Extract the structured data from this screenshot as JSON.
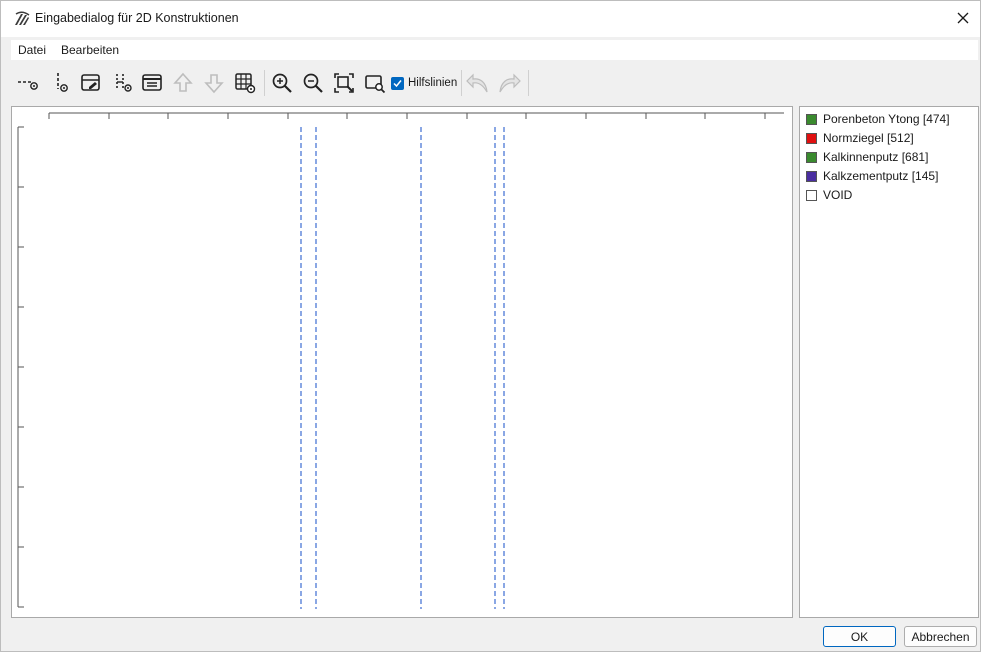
{
  "window": {
    "title": "Eingabedialog für 2D Konstruktionen"
  },
  "menu": {
    "items": [
      "Datei",
      "Bearbeiten"
    ]
  },
  "toolbar": {
    "hilfslinien_label": "Hilfslinien",
    "hilfslinien_checked": true,
    "buttons": [
      {
        "name": "add-horizontal-line-button",
        "icon": "horizontal-line-add-icon",
        "enabled": true
      },
      {
        "name": "add-vertical-line-button",
        "icon": "vertical-line-add-icon",
        "enabled": true
      },
      {
        "name": "edit-layer-button",
        "icon": "layer-edit-icon",
        "enabled": true
      },
      {
        "name": "split-layer-button",
        "icon": "layer-split-icon",
        "enabled": true
      },
      {
        "name": "material-list-button",
        "icon": "list-box-icon",
        "enabled": true
      },
      {
        "name": "move-up-button",
        "icon": "arrow-up-icon",
        "enabled": false
      },
      {
        "name": "move-down-button",
        "icon": "arrow-down-icon",
        "enabled": false
      },
      {
        "name": "grid-settings-button",
        "icon": "grid-gear-icon",
        "enabled": true
      },
      {
        "name": "zoom-in-button",
        "icon": "zoom-in-icon",
        "enabled": true
      },
      {
        "name": "zoom-out-button",
        "icon": "zoom-out-icon",
        "enabled": true
      },
      {
        "name": "zoom-fit-button",
        "icon": "zoom-fit-icon",
        "enabled": true
      },
      {
        "name": "zoom-window-button",
        "icon": "zoom-window-icon",
        "enabled": true
      },
      {
        "name": "undo-button",
        "icon": "undo-icon",
        "enabled": false
      },
      {
        "name": "redo-button",
        "icon": "redo-icon",
        "enabled": false
      }
    ]
  },
  "legend": {
    "items": [
      {
        "label": "Porenbeton Ytong [474]",
        "color": "#3a8a2e"
      },
      {
        "label": "Normziegel [512]",
        "color": "#e01010"
      },
      {
        "label": "Kalkinnenputz [681]",
        "color": "#3a8a2e"
      },
      {
        "label": "Kalkzementputz [145]",
        "color": "#4a2ea0"
      },
      {
        "label": "VOID",
        "color": "#ffffff"
      }
    ]
  },
  "canvas": {
    "guide_line_color": "#2b5fce",
    "guide_line_count": 5
  },
  "buttons": {
    "ok": "OK",
    "cancel": "Abbrechen"
  },
  "colors": {
    "accent": "#0067c0"
  }
}
